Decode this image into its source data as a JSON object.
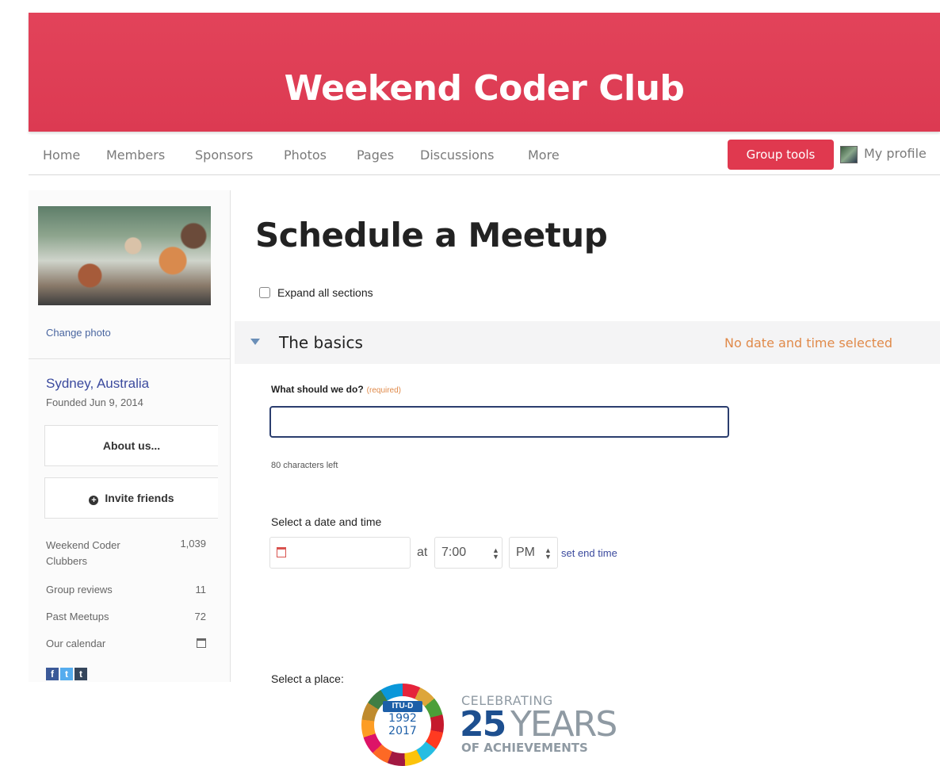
{
  "banner": {
    "title": "Weekend Coder Club"
  },
  "nav": {
    "items": [
      {
        "label": "Home"
      },
      {
        "label": "Members"
      },
      {
        "label": "Sponsors"
      },
      {
        "label": "Photos"
      },
      {
        "label": "Pages"
      },
      {
        "label": "Discussions"
      },
      {
        "label": "More"
      }
    ],
    "group_tools": "Group tools",
    "my_profile": "My profile"
  },
  "sidebar": {
    "change_photo": "Change photo",
    "city": "Sydney, Australia",
    "founded": "Founded Jun 9, 2014",
    "about_us": "About us...",
    "invite_friends": "Invite friends",
    "stats": [
      {
        "label": "Weekend Coder Clubbers",
        "value": "1,039"
      },
      {
        "label": "Group reviews",
        "value": "11"
      },
      {
        "label": "Past Meetups",
        "value": "72"
      },
      {
        "label": "Our calendar",
        "value": ""
      }
    ],
    "social": [
      "f",
      "t",
      "t"
    ]
  },
  "main": {
    "title": "Schedule a Meetup",
    "expand_all": "Expand all sections",
    "section": {
      "title": "The basics",
      "status": "No date and time selected"
    },
    "what_label": "What should we do?",
    "required": "(required)",
    "what_value": "",
    "chars_left": "80 characters left",
    "date_label": "Select a date and time",
    "at": "at",
    "time": "7:00",
    "ampm": "PM",
    "set_end": "set end time",
    "place_label": "Select a place:"
  },
  "logo": {
    "itu": "ITU-D",
    "year_start": "1992",
    "year_end": "2017",
    "celebrating": "CELEBRATING",
    "number": "25",
    "years": "YEARS",
    "achievements": "OF ACHIEVEMENTS"
  },
  "colors": {
    "banner": "#e2435a",
    "group_tools": "#e0394f",
    "link": "#3b4a9e",
    "status": "#e08a4a"
  }
}
